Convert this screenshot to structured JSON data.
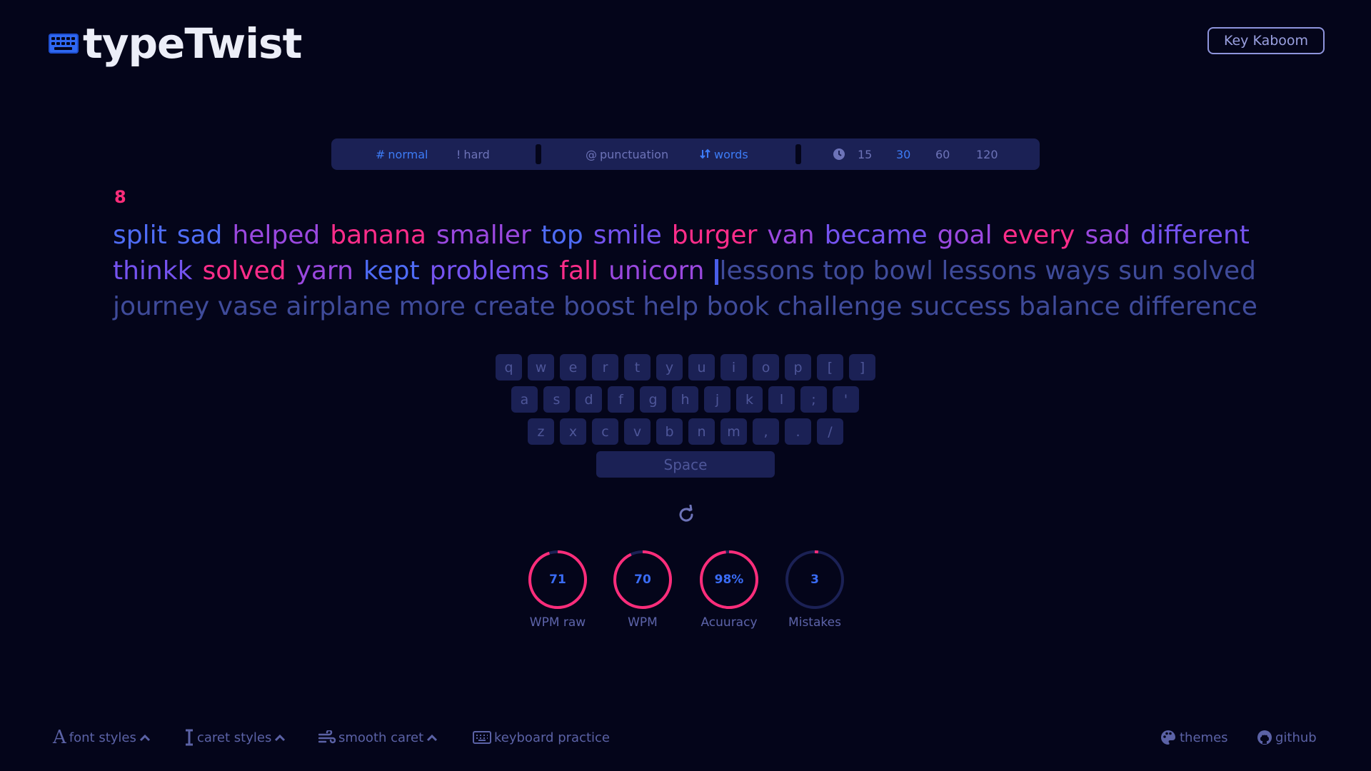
{
  "app": {
    "title": "typeTwist"
  },
  "header": {
    "key_button": "Key Kaboom"
  },
  "mode_bar": {
    "normal": "normal",
    "hard": "hard",
    "punctuation": "punctuation",
    "words": "words",
    "times": [
      "15",
      "30",
      "60",
      "120"
    ],
    "active_time": "30",
    "normal_prefix": "#",
    "hard_prefix": "!",
    "punct_prefix": "@"
  },
  "counter": "8",
  "words": {
    "line1": [
      {
        "t": "split",
        "c": "blue"
      },
      {
        "t": "sad",
        "c": "blue"
      },
      {
        "t": "helped",
        "c": "purple"
      },
      {
        "t": "banana",
        "c": "pink"
      },
      {
        "t": "smaller",
        "c": "purple"
      },
      {
        "t": "top",
        "c": "blue"
      },
      {
        "t": "smile",
        "c": "violet"
      },
      {
        "t": "burger",
        "c": "pink"
      },
      {
        "t": "van",
        "c": "purple"
      },
      {
        "t": "became",
        "c": "violet"
      },
      {
        "t": "goal",
        "c": "purple"
      },
      {
        "t": "every",
        "c": "pink"
      },
      {
        "t": "sad",
        "c": "purple"
      },
      {
        "t": "different",
        "c": "violet"
      }
    ],
    "line2_typed": [
      {
        "t": "thinkk",
        "c": "violet"
      },
      {
        "t": "solved",
        "c": "pink"
      },
      {
        "t": "yarn",
        "c": "purple"
      },
      {
        "t": "kept",
        "c": "blue"
      },
      {
        "t": "problems",
        "c": "violet"
      },
      {
        "t": "fall",
        "c": "pink"
      },
      {
        "t": "unicorn",
        "c": "purple"
      }
    ],
    "line2_pending": "lessons top bowl lessons ways sun solved",
    "line3": "journey vase airplane more create boost help book challenge success balance difference"
  },
  "keyboard": {
    "row1": [
      "q",
      "w",
      "e",
      "r",
      "t",
      "y",
      "u",
      "i",
      "o",
      "p",
      "[",
      "]"
    ],
    "row2": [
      "a",
      "s",
      "d",
      "f",
      "g",
      "h",
      "j",
      "k",
      "l",
      ";",
      "'"
    ],
    "row3": [
      "z",
      "x",
      "c",
      "v",
      "b",
      "n",
      "m",
      ",",
      ".",
      "/"
    ],
    "space": "Space"
  },
  "stats": [
    {
      "value": "71",
      "label": "WPM raw",
      "fill": 0.95
    },
    {
      "value": "70",
      "label": "WPM",
      "fill": 0.93
    },
    {
      "value": "98%",
      "label": "Acuuracy",
      "fill": 0.98
    },
    {
      "value": "3",
      "label": "Mistakes",
      "fill": 0.02
    }
  ],
  "footer": {
    "font_styles": "font styles",
    "caret_styles": "caret styles",
    "smooth_caret": "smooth caret",
    "keyboard_practice": "keyboard practice",
    "themes": "themes",
    "github": "github"
  },
  "colors": {
    "bg": "#04051a",
    "accent_blue": "#3d7cf7",
    "accent_pink": "#ff2d7a",
    "panel": "#1b2155"
  }
}
